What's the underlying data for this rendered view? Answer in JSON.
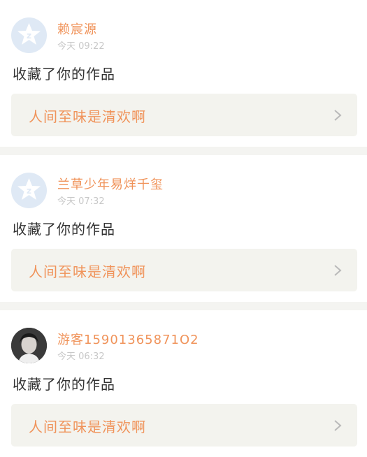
{
  "feed": {
    "items": [
      {
        "username": "赖宸源",
        "timestamp": "今天 09:22",
        "avatar": "default-avatar-icon",
        "action": "收藏了你的作品",
        "work_title": "人间至味是清欢啊"
      },
      {
        "username": "兰草少年易烊千玺",
        "timestamp": "今天 07:32",
        "avatar": "default-avatar-icon",
        "action": "收藏了你的作品",
        "work_title": "人间至味是清欢啊"
      },
      {
        "username": "游客15901365871O2",
        "timestamp": "今天 06:32",
        "avatar": "user-photo-avatar",
        "action": "收藏了你的作品",
        "work_title": "人间至味是清欢啊"
      }
    ]
  },
  "colors": {
    "accent": "#f0935a",
    "card_bg": "#f3f3ee",
    "separator": "#f4f4f1",
    "avatar_default_bg": "#dfe9f5"
  }
}
